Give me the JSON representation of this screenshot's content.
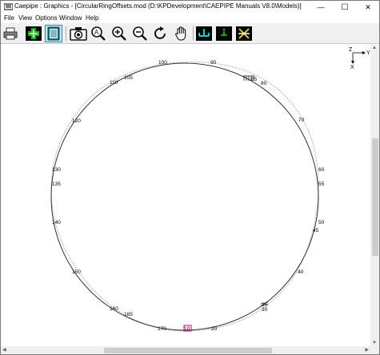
{
  "window": {
    "title": "Caepipe : Graphics - [CircularRingOffsets.mod (D:\\KPDevelopment\\CAEPIPE Manuals V8.0\\Models)]",
    "minimize": "—",
    "maximize": "☐",
    "close": "✕"
  },
  "menu": {
    "file": "File",
    "view": "View",
    "options": "Options",
    "window": "Window",
    "help": "Help"
  },
  "toolbar": [
    {
      "name": "print-icon"
    },
    {
      "name": "add-element-icon"
    },
    {
      "name": "list-view-icon"
    },
    {
      "name": "camera-icon"
    },
    {
      "name": "zoom-window-icon"
    },
    {
      "name": "zoom-in-icon"
    },
    {
      "name": "zoom-out-icon"
    },
    {
      "name": "rotate-icon"
    },
    {
      "name": "pan-hand-icon"
    },
    {
      "name": "show-anchor-icon"
    },
    {
      "name": "show-nodes-icon"
    },
    {
      "name": "show-hangers-icon"
    }
  ],
  "axes": {
    "z": "Z",
    "y": "Y",
    "x": "X"
  },
  "nodes": {
    "n10": "10",
    "n20": "20",
    "n30": "30",
    "n35": "35",
    "n40": "40",
    "n45": "45",
    "n50": "50",
    "n55": "55",
    "n60": "60",
    "n70": "70",
    "n80": "80",
    "n85": "85",
    "n90": "90",
    "n100": "100",
    "n105": "105",
    "n110": "110",
    "n120": "120",
    "n130": "130",
    "n135": "135",
    "n140": "140",
    "n150": "150",
    "n160": "160",
    "n165": "165",
    "n170": "170"
  },
  "colors": {
    "model_line": "#333333",
    "offset_line": "#9a9a9a",
    "anchor": "#e0007a",
    "toolbar_green": "#00a000",
    "toolbar_teal": "#0a6f7a"
  }
}
